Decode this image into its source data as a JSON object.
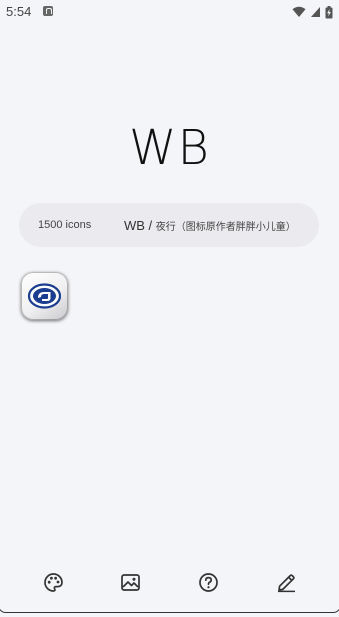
{
  "status_bar": {
    "time": "5:54"
  },
  "header": {
    "title": "WB"
  },
  "info": {
    "icon_count": "1500 icons",
    "pack_name": "WB / ",
    "pack_subtitle": "夜行（图标原作者胖胖小儿童）"
  },
  "icons": [
    {
      "name": "railway-app-icon"
    }
  ],
  "bottom_nav": [
    {
      "name": "palette-icon"
    },
    {
      "name": "wallpaper-icon"
    },
    {
      "name": "help-icon"
    },
    {
      "name": "edit-icon"
    }
  ]
}
